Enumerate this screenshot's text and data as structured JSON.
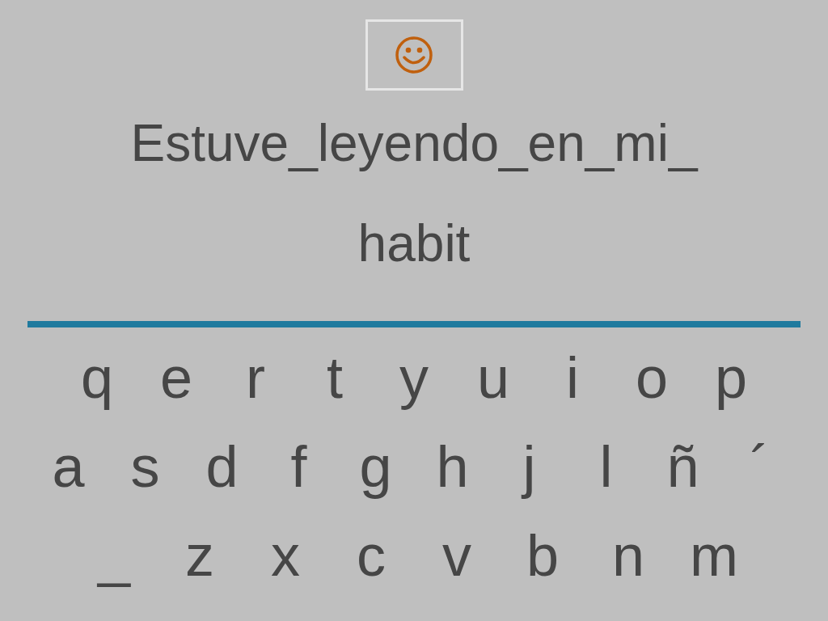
{
  "sentence_lines": [
    "Estuve_leyendo_en_mi_",
    "habit"
  ],
  "keyboard_rows": [
    [
      "q",
      "e",
      "r",
      "t",
      "y",
      "u",
      "i",
      "o",
      "p"
    ],
    [
      "a",
      "s",
      "d",
      "f",
      "g",
      "h",
      "j",
      "l",
      "ñ",
      "´"
    ],
    [
      "_",
      "z",
      "x",
      "c",
      "v",
      "b",
      "n",
      "m"
    ]
  ]
}
